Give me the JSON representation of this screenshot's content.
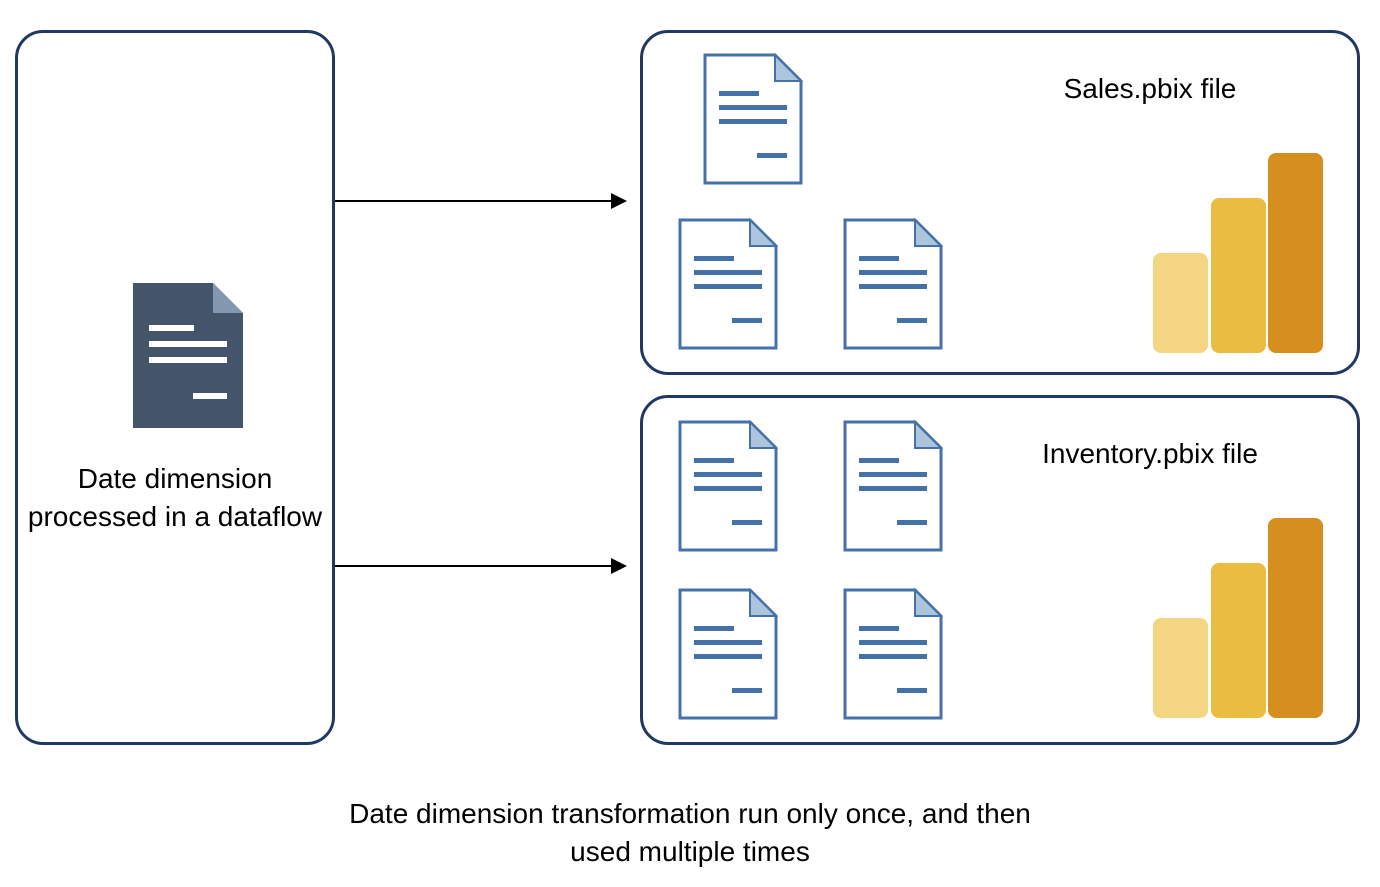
{
  "left": {
    "label": "Date dimension processed in a dataflow"
  },
  "top_box": {
    "label": "Sales.pbix file"
  },
  "bottom_box": {
    "label": "Inventory.pbix file"
  },
  "caption": "Date dimension transformation run only once, and then used multiple times",
  "icons": {
    "doc_solid": "document-solid-icon",
    "doc_outline": "document-outline-icon",
    "powerbi": "powerbi-icon"
  },
  "colors": {
    "border": "#203864",
    "doc_solid_fill": "#44546A",
    "doc_solid_fold": "#8497B0",
    "doc_outline_stroke": "#4472A8",
    "doc_outline_fold": "#ACC4DC",
    "pbi_dark": "#D68E1E",
    "pbi_mid": "#EBBC42",
    "pbi_light": "#F3D582"
  }
}
